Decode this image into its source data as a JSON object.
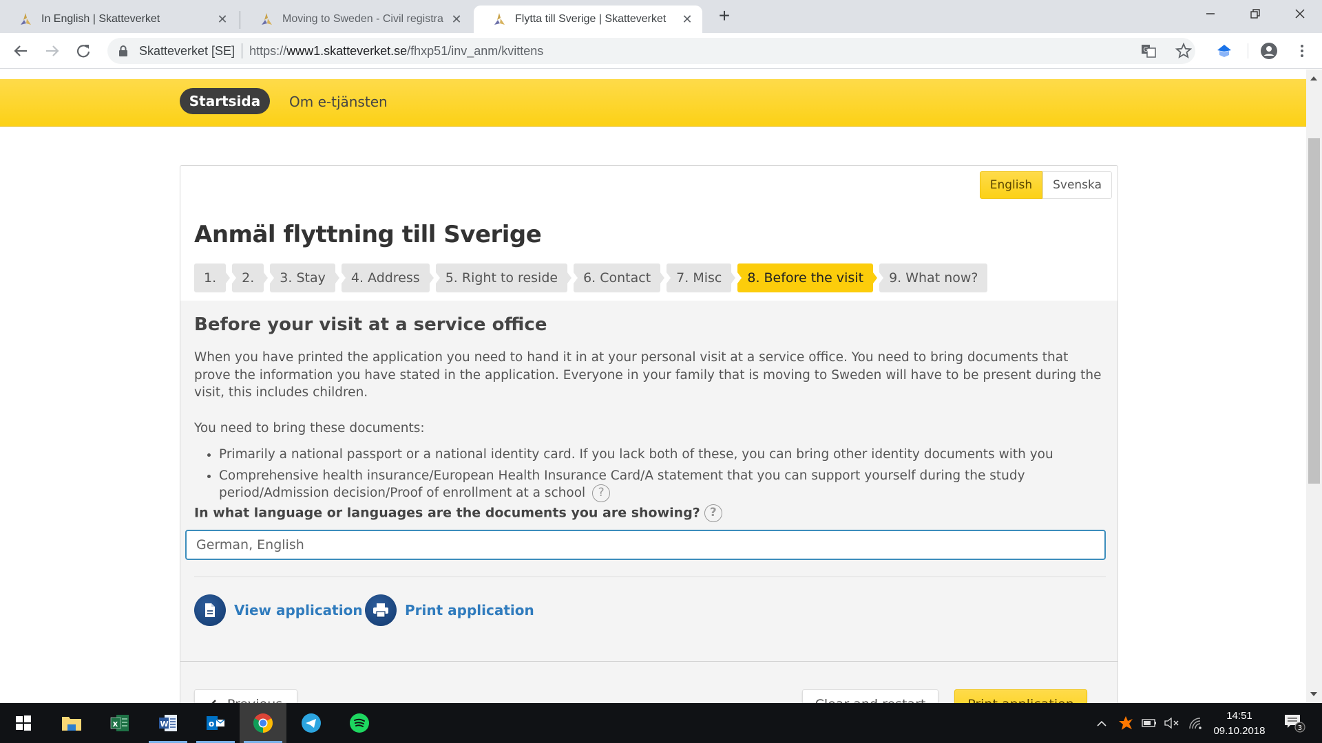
{
  "browser": {
    "tabs": [
      {
        "title": "In English | Skatteverket",
        "active": false
      },
      {
        "title": "Moving to Sweden - Civil registra",
        "active": false
      },
      {
        "title": "Flytta till Sverige | Skatteverket",
        "active": true
      }
    ],
    "new_tab_label": "+",
    "close_glyph": "✕",
    "window_controls": {
      "minimize": "minimize-icon",
      "restore": "restore-icon",
      "close": "close-icon"
    },
    "address_bar": {
      "site_identity": "Skatteverket [SE]",
      "url_prefix": "https://",
      "url_domain": "www1.skatteverket.se",
      "url_path": "/fhxp51/inv_anm/kvittens"
    }
  },
  "site_header": {
    "home_label": "Startsida",
    "about_label": "Om e-tjänsten"
  },
  "language_switch": {
    "english": "English",
    "swedish": "Svenska",
    "selected": "English"
  },
  "page_title": "Anmäl flyttning till Sverige",
  "steps": [
    {
      "label": "1.",
      "active": false
    },
    {
      "label": "2.",
      "active": false
    },
    {
      "label": "3. Stay",
      "active": false
    },
    {
      "label": "4. Address",
      "active": false
    },
    {
      "label": "5. Right to reside",
      "active": false
    },
    {
      "label": "6. Contact",
      "active": false
    },
    {
      "label": "7. Misc",
      "active": false
    },
    {
      "label": "8. Before the visit",
      "active": true
    },
    {
      "label": "9. What now?",
      "active": false
    }
  ],
  "section": {
    "title": "Before your visit at a service office",
    "intro": "When you have printed the application you need to hand it in at your personal visit at a service office. You need to bring documents that prove the information you have stated in the application. Everyone in your family that is moving to Sweden will have to be present during the visit, this includes children.",
    "documents_heading": "You need to bring these documents:",
    "documents": [
      "Primarily a national passport or a national identity card. If you lack both of these, you can bring other identity documents with you",
      "Comprehensive health insurance/European Health Insurance Card/A statement that you can support yourself during the study period/Admission decision/Proof of enrollment at a school"
    ],
    "help_glyph": "?",
    "language_question": "In what language or languages are the documents you are showing?",
    "language_answer": "German, English"
  },
  "actions": {
    "view_application": "View application",
    "print_application": "Print application"
  },
  "footer_buttons": {
    "previous": "Previous",
    "clear": "Clear and restart",
    "print": "Print application"
  },
  "taskbar": {
    "apps": [
      "start",
      "file-explorer",
      "excel",
      "word",
      "outlook",
      "chrome",
      "telegram",
      "spotify"
    ],
    "time": "14:51",
    "date": "09.10.2018",
    "notification_count": "3"
  },
  "colors": {
    "brand_yellow": "#fcd116",
    "link_blue": "#2f7bbd",
    "focus_blue": "#3c8dbc",
    "icon_navy": "#12396e"
  }
}
